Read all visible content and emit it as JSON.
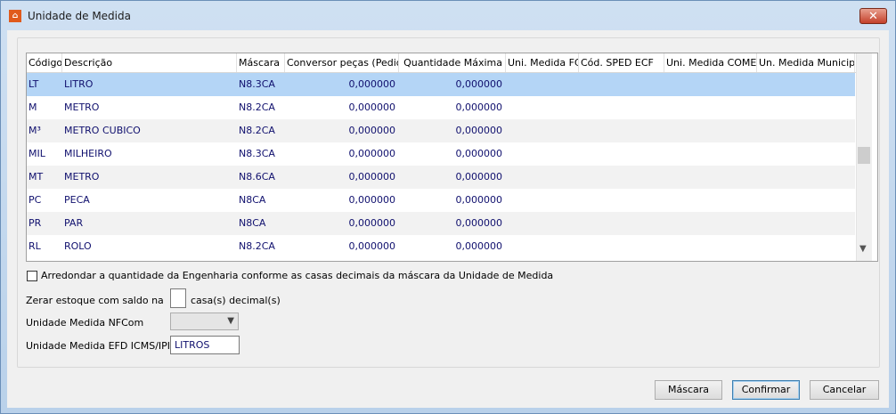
{
  "window": {
    "title": "Unidade de Medida",
    "close_glyph": "✕"
  },
  "grid": {
    "columns": [
      "Código",
      "Descrição",
      "Máscara",
      "Conversor peças (Pedido)",
      "Quantidade Máxima",
      "Uni. Medida FCI",
      "Cód. SPED ECF",
      "Uni. Medida COMEX",
      "Un. Medida Municipal"
    ],
    "rows": [
      {
        "codigo": "LT",
        "descricao": "LITRO",
        "mascara": "N8.3CA",
        "conversor": "0,000000",
        "qtd_max": "0,000000",
        "selected": true
      },
      {
        "codigo": "M",
        "descricao": "METRO",
        "mascara": "N8.2CA",
        "conversor": "0,000000",
        "qtd_max": "0,000000"
      },
      {
        "codigo": "M³",
        "descricao": "METRO CUBICO",
        "mascara": "N8.2CA",
        "conversor": "0,000000",
        "qtd_max": "0,000000"
      },
      {
        "codigo": "MIL",
        "descricao": "MILHEIRO",
        "mascara": "N8.3CA",
        "conversor": "0,000000",
        "qtd_max": "0,000000"
      },
      {
        "codigo": "MT",
        "descricao": "METRO",
        "mascara": "N8.6CA",
        "conversor": "0,000000",
        "qtd_max": "0,000000"
      },
      {
        "codigo": "PC",
        "descricao": "PECA",
        "mascara": "N8CA",
        "conversor": "0,000000",
        "qtd_max": "0,000000"
      },
      {
        "codigo": "PR",
        "descricao": "PAR",
        "mascara": "N8CA",
        "conversor": "0,000000",
        "qtd_max": "0,000000"
      },
      {
        "codigo": "RL",
        "descricao": "ROLO",
        "mascara": "N8.2CA",
        "conversor": "0,000000",
        "qtd_max": "0,000000"
      }
    ]
  },
  "form": {
    "arredondar_label": "Arredondar a quantidade da Engenharia conforme as casas decimais da máscara da Unidade de Medida",
    "arredondar_checked": false,
    "zerar_label": "Zerar estoque com saldo na",
    "zerar_value": "",
    "zerar_suffix": "casa(s) decimal(s)",
    "nfcom_label": "Unidade Medida NFCom",
    "nfcom_value": "",
    "efd_label": "Unidade Medida EFD ICMS/IPI",
    "efd_value": "LITROS"
  },
  "buttons": {
    "mascara": "Máscara",
    "confirmar": "Confirmar",
    "cancelar": "Cancelar"
  }
}
